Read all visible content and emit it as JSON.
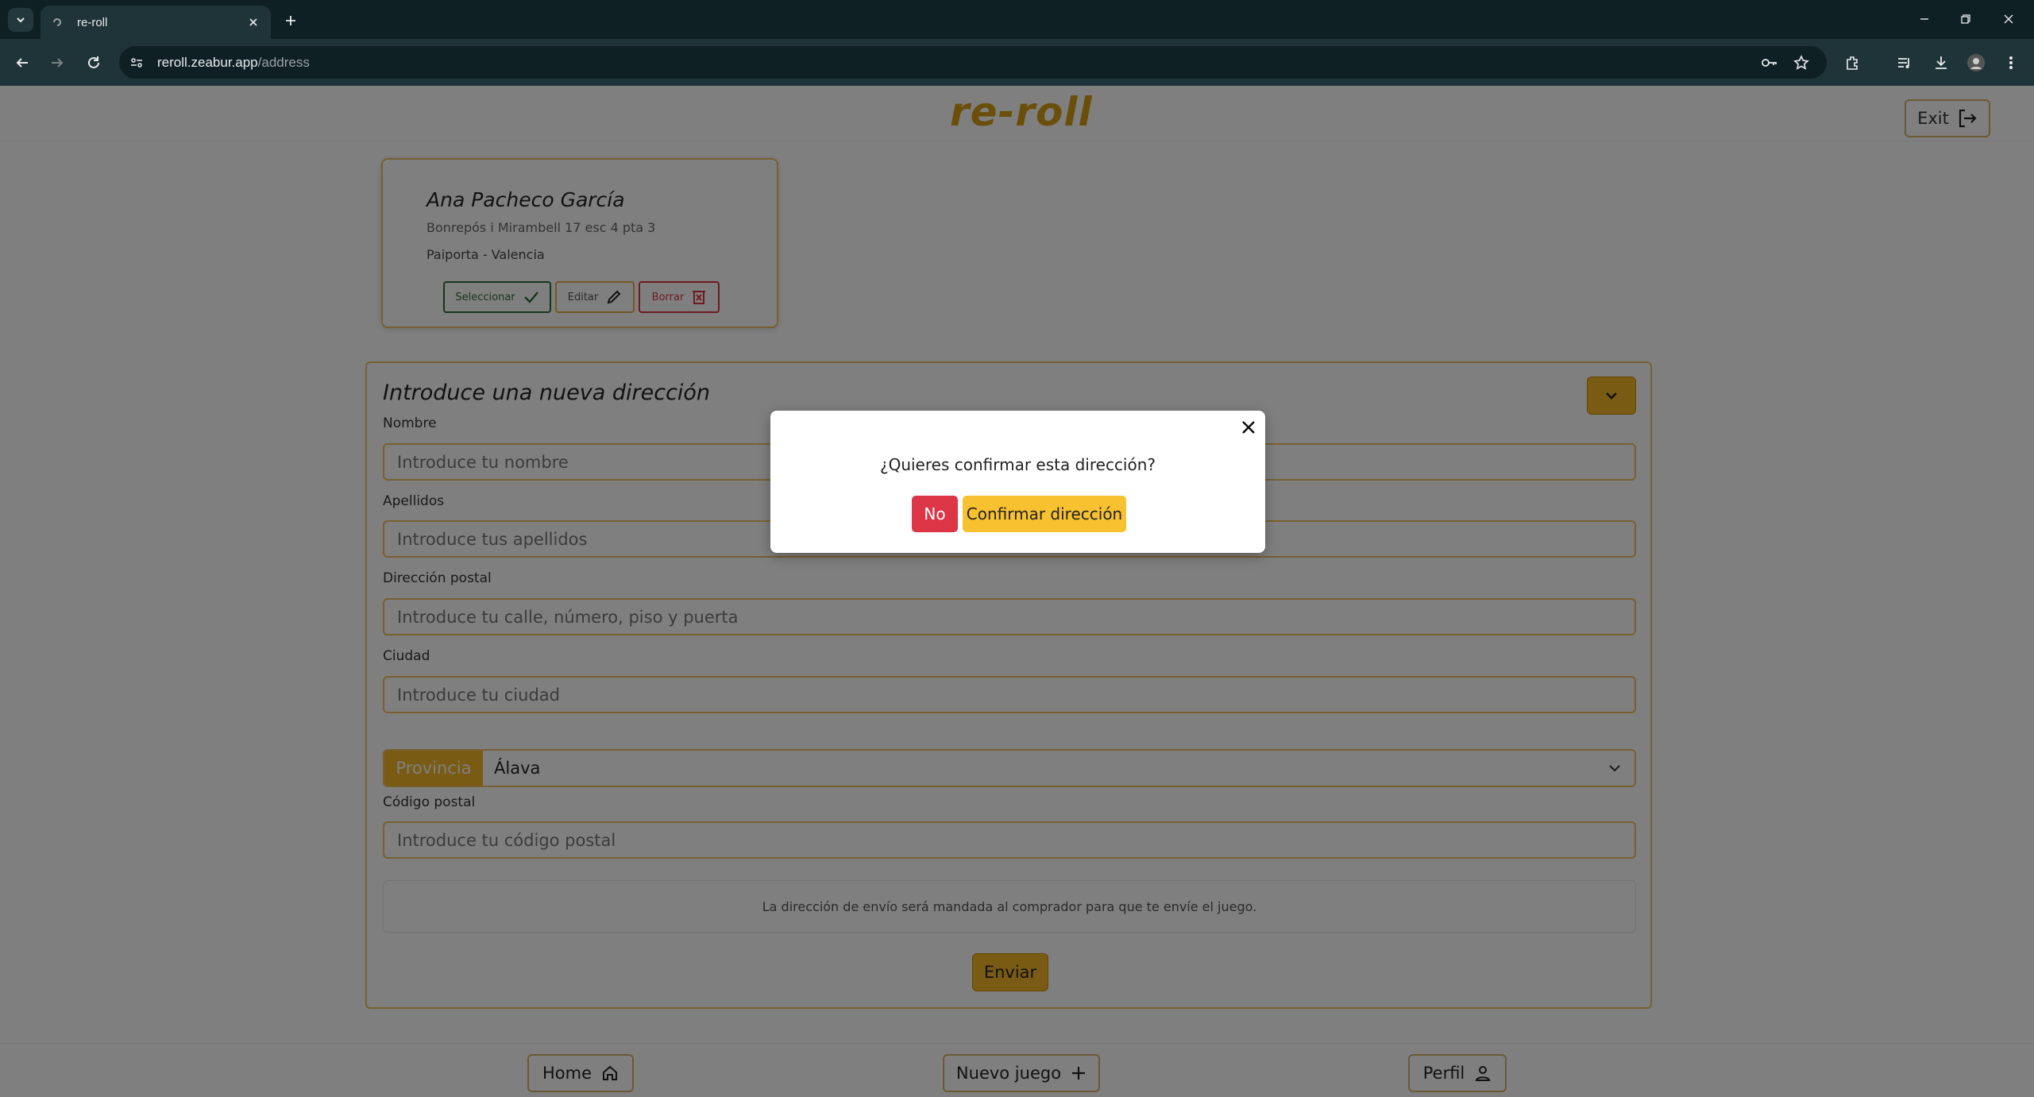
{
  "browser": {
    "tab_title": "re-roll",
    "url_host": "reroll.zeabur.app",
    "url_path": "/address"
  },
  "header": {
    "logo": "re-roll",
    "exit_label": "Exit"
  },
  "address_card": {
    "name": "Ana Pacheco García",
    "street": "Bonrepós i Mirambell 17 esc 4 pta 3",
    "city_line": "Paiporta - Valencia",
    "select_label": "Seleccionar",
    "edit_label": "Editar",
    "delete_label": "Borrar"
  },
  "form": {
    "title": "Introduce una nueva dirección",
    "nombre_label": "Nombre",
    "nombre_placeholder": "Introduce tu nombre",
    "apellidos_label": "Apellidos",
    "apellidos_placeholder": "Introduce tus apellidos",
    "direccion_label": "Dirección postal",
    "direccion_placeholder": "Introduce tu calle, número, piso y puerta",
    "ciudad_label": "Ciudad",
    "ciudad_placeholder": "Introduce tu ciudad",
    "provincia_label": "Provincia",
    "provincia_value": "Álava",
    "cp_label": "Código postal",
    "cp_placeholder": "Introduce tu código postal",
    "notice": "La dirección de envío será mandada al comprador para que te envíe el juego.",
    "submit_label": "Enviar"
  },
  "bottom_nav": {
    "home_label": "Home",
    "new_game_label": "Nuevo juego",
    "profile_label": "Perfil"
  },
  "modal": {
    "question": "¿Quieres confirmar esta dirección?",
    "no_label": "No",
    "confirm_label": "Confirmar dirección"
  },
  "colors": {
    "accent": "#f3b729",
    "logo": "#d49d14",
    "danger": "#dc3545",
    "success": "#2f6b3a",
    "chrome_bg": "#0f2024",
    "chrome_toolbar": "#1f3438"
  }
}
